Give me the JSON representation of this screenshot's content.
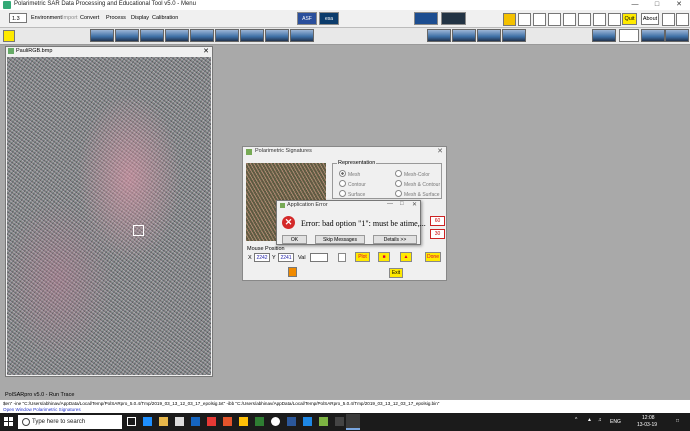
{
  "window": {
    "title": "Polarimetric SAR Data Processing and Educational Tool v5.0 - Menu"
  },
  "menu": {
    "version": "1.3",
    "items": [
      "Environment",
      "Import",
      "Convert",
      "Process",
      "Display",
      "Calibration"
    ],
    "quit_label": "Quit",
    "about_label": "About",
    "logos": {
      "asf": "ASF",
      "esa": "esa SNAP"
    }
  },
  "image_window": {
    "title": "PauliRGB.bmp"
  },
  "polarimetric_window": {
    "title": "Polarimetric Signatures",
    "representation_label": "Representation",
    "options": [
      "Mesh",
      "Mesh-Color",
      "Contour",
      "Mesh & Contour",
      "Surface",
      "Mesh & Surface"
    ],
    "val1": "60",
    "val2": "30",
    "mouse_position_label": "Mouse Position",
    "x_label": "X",
    "x_value": "2242",
    "y_label": "Y",
    "y_value": "2241",
    "val_label": "Val",
    "plot_label": "Plot",
    "done_label": "Done",
    "exit_label": "Exit"
  },
  "error_dialog": {
    "title": "Application Error",
    "message": "Error: bad option \"1\": must be atime,...",
    "ok_label": "OK",
    "skip_label": "Skip Messages",
    "details_label": "Details >>"
  },
  "run_trace": {
    "title": "PolSARpro v5.0 - Run Trace",
    "line1": "$en\" -ine \"C:/Users/abhinav/AppData/Local/Temp/PolSARpro_5.0.4/Tmp/2019_03_13_12_03_17_epolsig.txt\" -ibb \"C:/Users/abhinav/AppData/Local/Temp/PolSARpro_5.0.4/Tmp/2019_03_13_12_03_17_epolsig.bin\"",
    "line2": "Open Window Polarimetric Signatures"
  },
  "taskbar": {
    "search_placeholder": "Type here to search",
    "lang": "ENG",
    "time": "12:08",
    "date": "13-03-19"
  }
}
